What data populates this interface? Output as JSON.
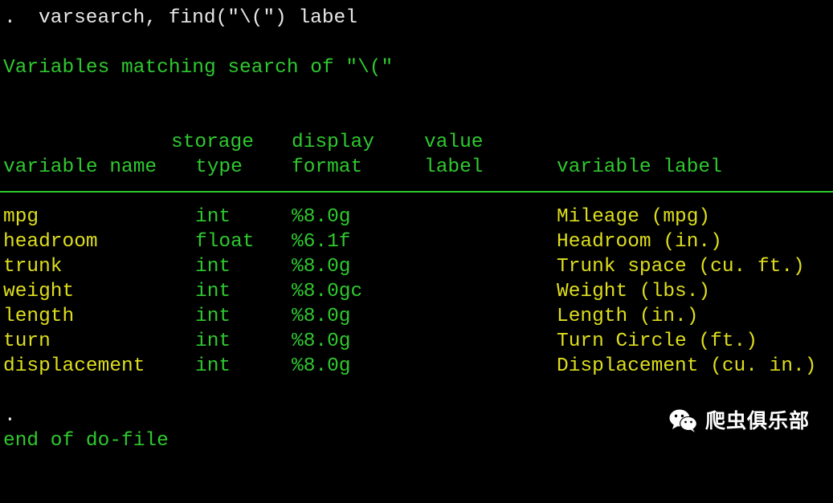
{
  "console": {
    "command_prompt": ".",
    "command": "varsearch, find(\"\\(\") label",
    "search_message": "Variables matching search of \"\\(\"",
    "header_row1": {
      "storage": "storage",
      "display": "display",
      "value": "value"
    },
    "header_row2": {
      "variable_name": "variable name",
      "type": "type",
      "format": "format",
      "label": "label",
      "variable_label": "variable label"
    },
    "rows": [
      {
        "name": "mpg",
        "type": "int",
        "format": "%8.0g",
        "label": "Mileage (mpg)"
      },
      {
        "name": "headroom",
        "type": "float",
        "format": "%6.1f",
        "label": "Headroom (in.)"
      },
      {
        "name": "trunk",
        "type": "int",
        "format": "%8.0g",
        "label": "Trunk space (cu. ft.)"
      },
      {
        "name": "weight",
        "type": "int",
        "format": "%8.0gc",
        "label": "Weight (lbs.)"
      },
      {
        "name": "length",
        "type": "int",
        "format": "%8.0g",
        "label": "Length (in.)"
      },
      {
        "name": "turn",
        "type": "int",
        "format": "%8.0g",
        "label": "Turn Circle (ft.)"
      },
      {
        "name": "displacement",
        "type": "int",
        "format": "%8.0g",
        "label": "Displacement (cu. in.)"
      }
    ],
    "end_prompt": ".",
    "end_message": "end of do-file"
  },
  "watermark": {
    "icon": "wechat-icon",
    "text": "爬虫俱乐部"
  },
  "colors": {
    "background": "#000000",
    "prompt": "#e8e8e8",
    "green": "#2fc92f",
    "yellow": "#dede1f"
  }
}
